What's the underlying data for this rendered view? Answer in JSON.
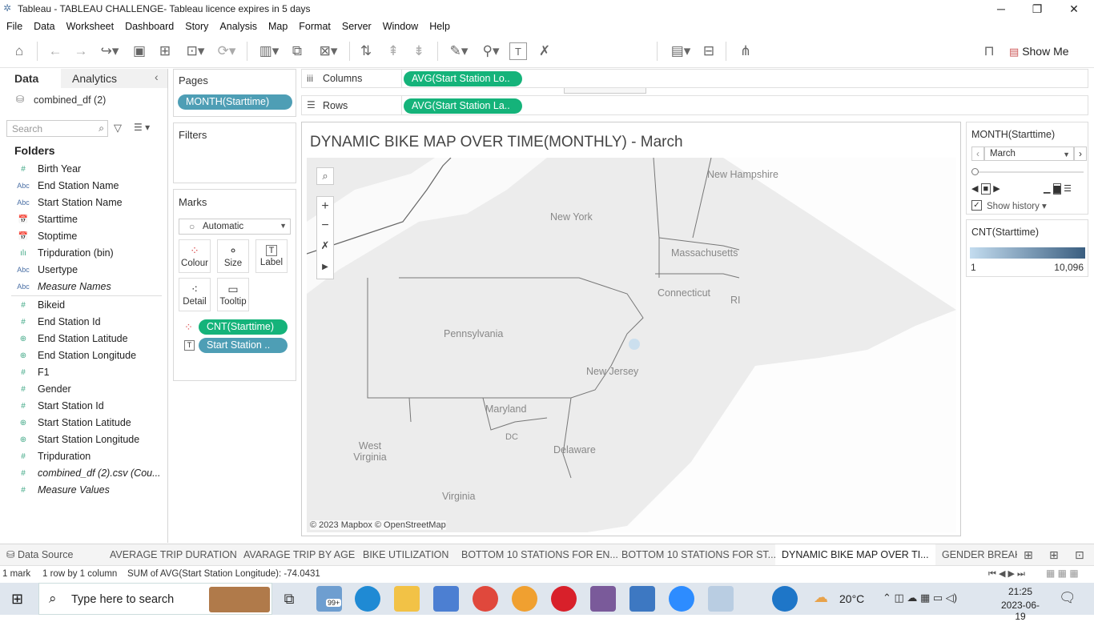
{
  "window": {
    "title": "Tableau - TABLEAU CHALLENGE- Tableau licence expires in 5 days",
    "min": "─",
    "max": "❐",
    "close": "✕"
  },
  "menu": [
    "File",
    "Data",
    "Worksheet",
    "Dashboard",
    "Story",
    "Analysis",
    "Map",
    "Format",
    "Server",
    "Window",
    "Help"
  ],
  "toolbar": {
    "show_me": "Show Me"
  },
  "data_pane": {
    "tab_data": "Data",
    "tab_analytics": "Analytics",
    "datasource": "combined_df (2)",
    "search_placeholder": "Search",
    "folders_heading": "Folders",
    "dimensions": [
      {
        "icon": "#",
        "name": "Birth Year"
      },
      {
        "icon": "Abc",
        "name": "End Station Name"
      },
      {
        "icon": "Abc",
        "name": "Start Station Name"
      },
      {
        "icon": "📅",
        "name": "Starttime"
      },
      {
        "icon": "📅",
        "name": "Stoptime"
      },
      {
        "icon": "ılı",
        "name": "Tripduration (bin)"
      },
      {
        "icon": "Abc",
        "name": "Usertype"
      },
      {
        "icon": "Abc",
        "name": "Measure Names"
      }
    ],
    "measures": [
      {
        "icon": "#",
        "name": "Bikeid"
      },
      {
        "icon": "#",
        "name": "End Station Id"
      },
      {
        "icon": "⊕",
        "name": "End Station Latitude"
      },
      {
        "icon": "⊕",
        "name": "End Station Longitude"
      },
      {
        "icon": "#",
        "name": "F1"
      },
      {
        "icon": "#",
        "name": "Gender"
      },
      {
        "icon": "#",
        "name": "Start Station Id"
      },
      {
        "icon": "⊕",
        "name": "Start Station Latitude"
      },
      {
        "icon": "⊕",
        "name": "Start Station Longitude"
      },
      {
        "icon": "#",
        "name": "Tripduration"
      },
      {
        "icon": "#",
        "name": "combined_df (2).csv (Cou..."
      },
      {
        "icon": "#",
        "name": "Measure Values"
      }
    ]
  },
  "pages": {
    "label": "Pages",
    "pill": "MONTH(Starttime)"
  },
  "filters": {
    "label": "Filters"
  },
  "marks": {
    "label": "Marks",
    "type": "Automatic",
    "buttons": [
      "Colour",
      "Size",
      "Label",
      "Detail",
      "Tooltip"
    ],
    "pill_colour": "CNT(Starttime)",
    "pill_label": "Start Station .."
  },
  "shelves": {
    "columns_label": "Columns",
    "columns_pill": "AVG(Start Station Lo..",
    "rows_label": "Rows",
    "rows_pill": "AVG(Start Station La.."
  },
  "view": {
    "title": "DYNAMIC BIKE MAP OVER TIME(MONTHLY) - March",
    "attribution": "© 2023 Mapbox © OpenStreetMap",
    "labels": [
      {
        "text": "New Hampshire"
      },
      {
        "text": "New York"
      },
      {
        "text": "Massachusetts"
      },
      {
        "text": "Connecticut"
      },
      {
        "text": "RI"
      },
      {
        "text": "Pennsylvania"
      },
      {
        "text": "New Jersey"
      },
      {
        "text": "Maryland"
      },
      {
        "text": "DC"
      },
      {
        "text": "West Virginia"
      },
      {
        "text": "Delaware"
      },
      {
        "text": "Virginia"
      }
    ]
  },
  "page_control": {
    "title": "MONTH(Starttime)",
    "value": "March",
    "show_history": "Show history"
  },
  "legend": {
    "title": "CNT(Starttime)",
    "min": "1",
    "max": "10,096",
    "color_start": "#c3dcef",
    "color_end": "#3a5e80"
  },
  "sheet_tabs": {
    "data_source": "Data Source",
    "tabs": [
      "AVERAGE TRIP DURATION",
      "AVARAGE TRIP BY AGE",
      "BIKE UTILIZATION",
      "BOTTOM 10 STATIONS FOR EN...",
      "BOTTOM 10 STATIONS FOR ST...",
      "DYNAMIC BIKE MAP OVER TI...",
      "GENDER BREAKI"
    ]
  },
  "status": {
    "marks": "1 mark",
    "rows": "1 row by 1 column",
    "sum": "SUM of AVG(Start Station Longitude): -74.0431"
  },
  "taskbar": {
    "search": "Type here to search",
    "temp": "20°C",
    "time": "21:25",
    "date": "2023-06-19",
    "badge": "99+"
  }
}
